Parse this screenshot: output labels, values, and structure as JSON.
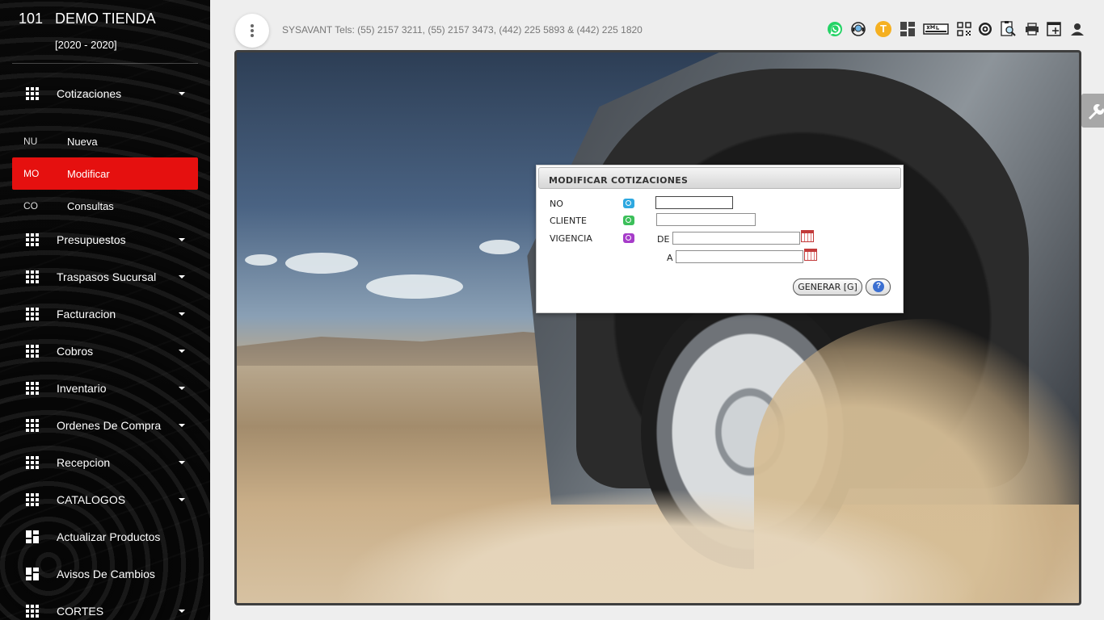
{
  "brand": {
    "number": "101",
    "name": "DEMO TIENDA",
    "years": "[2020 - 2020]"
  },
  "sidebar": {
    "items": [
      {
        "label": "Cotizaciones",
        "icon": "apps-grid-icon"
      },
      {
        "label": "Presupuestos",
        "icon": "apps-grid-icon"
      },
      {
        "label": "Traspasos Sucursal",
        "icon": "apps-grid-icon"
      },
      {
        "label": "Facturacion",
        "icon": "apps-grid-icon"
      },
      {
        "label": "Cobros",
        "icon": "apps-grid-icon"
      },
      {
        "label": "Inventario",
        "icon": "apps-grid-icon"
      },
      {
        "label": "Ordenes De Compra",
        "icon": "apps-grid-icon"
      },
      {
        "label": "Recepcion",
        "icon": "apps-grid-icon"
      },
      {
        "label": "CATALOGOS",
        "icon": "apps-grid-icon"
      },
      {
        "label": "Actualizar Productos",
        "icon": "dashboard-icon"
      },
      {
        "label": "Avisos De Cambios",
        "icon": "dashboard-icon"
      },
      {
        "label": "CORTES",
        "icon": "apps-grid-icon"
      }
    ],
    "subitems": [
      {
        "abbr": "NU",
        "label": "Nueva"
      },
      {
        "abbr": "MO",
        "label": "Modificar"
      },
      {
        "abbr": "CO",
        "label": "Consultas"
      }
    ]
  },
  "topbar": {
    "info": "SYSAVANT Tels: (55) 2157 3211, (55) 2157 3473, (442) 225 5893 & (442) 225 1820",
    "badge_letter": "T",
    "icons": [
      "whatsapp-icon",
      "support-agent-icon",
      "user-t-icon",
      "dashboard-icon",
      "xml-icon",
      "qr-code-icon",
      "target-icon",
      "report-search-icon",
      "printer-icon",
      "new-window-icon",
      "account-icon"
    ]
  },
  "modal": {
    "title": "MODIFICAR COTIZACIONES",
    "fields": {
      "no_label": "NO",
      "cliente_label": "CLIENTE",
      "vigencia_label": "VIGENCIA",
      "de_label": "DE",
      "a_label": "A",
      "no_value": "",
      "cliente_value": "",
      "de_value": "",
      "a_value": ""
    },
    "generate_label": "GENERAR [G]",
    "help_label": "?"
  },
  "colors": {
    "accent": "#e5100f",
    "lookup_no": "#2ea8e0",
    "lookup_cliente": "#3cbf5a",
    "lookup_vigencia": "#a63cc9",
    "badge": "#f5b021"
  }
}
